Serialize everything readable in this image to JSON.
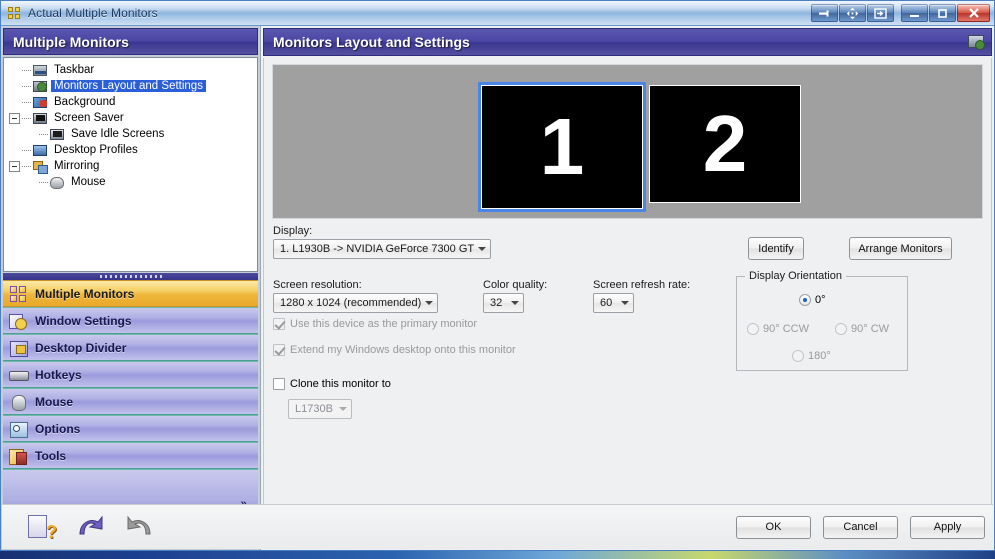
{
  "window": {
    "title": "Actual Multiple Monitors",
    "titlebar_buttons": [
      {
        "name": "pin-window-button",
        "glyph": "pin"
      },
      {
        "name": "move-window-button",
        "glyph": "move"
      },
      {
        "name": "send-to-monitor-button",
        "glyph": "sendto"
      },
      {
        "name": "minimize-button",
        "glyph": "minimize"
      },
      {
        "name": "maximize-button",
        "glyph": "maximize"
      },
      {
        "name": "close-button",
        "glyph": "close"
      }
    ]
  },
  "sidebar": {
    "header": "Multiple Monitors",
    "tree": [
      {
        "label": "Taskbar",
        "icon": "taskbar-icon",
        "indent": 1,
        "expander": "none",
        "selected": false
      },
      {
        "label": "Monitors Layout and Settings",
        "icon": "monitor-settings-icon",
        "indent": 1,
        "expander": "none",
        "selected": true
      },
      {
        "label": "Background",
        "icon": "background-icon",
        "indent": 1,
        "expander": "none",
        "selected": false
      },
      {
        "label": "Screen Saver",
        "icon": "screensaver-icon",
        "indent": 0,
        "expander": "minus",
        "selected": false
      },
      {
        "label": "Save Idle Screens",
        "icon": "save-idle-screens-icon",
        "indent": 2,
        "expander": "none",
        "selected": false
      },
      {
        "label": "Desktop Profiles",
        "icon": "desktop-profiles-icon",
        "indent": 1,
        "expander": "none",
        "selected": false
      },
      {
        "label": "Mirroring",
        "icon": "mirroring-icon",
        "indent": 0,
        "expander": "minus",
        "selected": false
      },
      {
        "label": "Mouse",
        "icon": "mouse-icon",
        "indent": 2,
        "expander": "none",
        "selected": false
      }
    ],
    "nav": [
      {
        "label": "Multiple Monitors",
        "icon": "multiple-monitors-icon",
        "active": true
      },
      {
        "label": "Window Settings",
        "icon": "window-settings-icon",
        "active": false
      },
      {
        "label": "Desktop Divider",
        "icon": "desktop-divider-icon",
        "active": false
      },
      {
        "label": "Hotkeys",
        "icon": "hotkeys-icon",
        "active": false
      },
      {
        "label": "Mouse",
        "icon": "mouse-icon",
        "active": false
      },
      {
        "label": "Options",
        "icon": "options-icon",
        "active": false
      },
      {
        "label": "Tools",
        "icon": "tools-icon",
        "active": false
      }
    ],
    "more_chevron": "»"
  },
  "main": {
    "header": "Monitors Layout and Settings",
    "preview": {
      "monitors": [
        {
          "number": "1",
          "selected": true
        },
        {
          "number": "2",
          "selected": false
        }
      ]
    },
    "display_label": "Display:",
    "display_value": "1. L1930B -> NVIDIA GeForce 7300 GT",
    "identify_button": "Identify",
    "arrange_button": "Arrange Monitors",
    "resolution_label": "Screen resolution:",
    "resolution_value": "1280 x 1024 (recommended)",
    "color_quality_label": "Color quality:",
    "color_quality_value": "32",
    "refresh_label": "Screen refresh rate:",
    "refresh_value": "60",
    "primary_checkbox": "Use this device as the primary monitor",
    "extend_checkbox": "Extend my Windows desktop onto this monitor",
    "clone_checkbox": "Clone this monitor to",
    "clone_target_value": "L1730B",
    "orientation": {
      "title": "Display Orientation",
      "options": [
        {
          "label": "0°",
          "selected": true,
          "disabled": false
        },
        {
          "label": "90° CCW",
          "selected": false,
          "disabled": true
        },
        {
          "label": "90° CW",
          "selected": false,
          "disabled": true
        },
        {
          "label": "180°",
          "selected": false,
          "disabled": true
        }
      ]
    }
  },
  "footer": {
    "tools": [
      {
        "name": "help-button",
        "icon": "help-icon"
      },
      {
        "name": "undo-button",
        "icon": "undo-icon"
      },
      {
        "name": "redo-button",
        "icon": "redo-icon"
      }
    ],
    "ok": "OK",
    "cancel": "Cancel",
    "apply": "Apply"
  },
  "colors": {
    "header_purple": "#3a3691",
    "nav_active": "#edb63b",
    "selection_blue": "#2b5fd9",
    "monitor_select": "#4a86e8"
  }
}
